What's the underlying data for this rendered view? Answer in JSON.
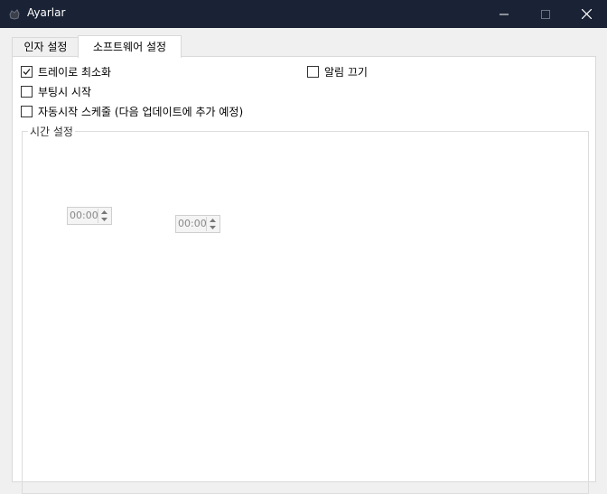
{
  "window": {
    "title": "Ayarlar",
    "icon": "app-logo-icon",
    "controls": [
      "minimize-icon",
      "maximize-icon",
      "close-icon"
    ]
  },
  "tabs": [
    {
      "label": "인자 설정",
      "active": false
    },
    {
      "label": "소프트웨어 설정",
      "active": true
    }
  ],
  "options": {
    "minimize_to_tray": {
      "label": "트레이로 최소화",
      "checked": true
    },
    "mute_alerts": {
      "label": "알림 끄기",
      "checked": false
    },
    "start_on_boot": {
      "label": "부팅시 시작",
      "checked": false
    },
    "auto_start_schedule": {
      "label": "자동시작 스케줄 (다음 업데이트에 추가 예정)",
      "checked": false
    }
  },
  "time_settings": {
    "label": "시간 설정",
    "start_time": "00:00",
    "end_time": "00:00",
    "enabled": false
  }
}
